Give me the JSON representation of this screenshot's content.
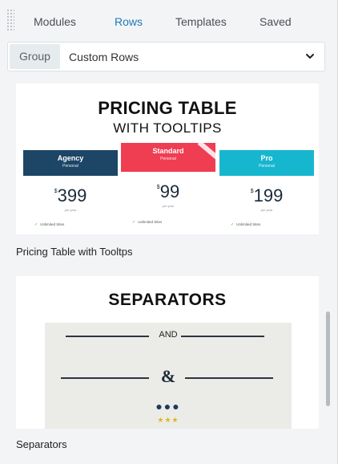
{
  "tabs": [
    {
      "label": "Modules",
      "active": false
    },
    {
      "label": "Rows",
      "active": true
    },
    {
      "label": "Templates",
      "active": false
    },
    {
      "label": "Saved",
      "active": false
    }
  ],
  "selector": {
    "group_label": "Group",
    "value": "Custom Rows",
    "icon": "chevron-down-icon"
  },
  "colors": {
    "accent": "#1e79b8",
    "agency": "#1d4566",
    "standard": "#ef3d52",
    "pro": "#17b6cf"
  },
  "items": [
    {
      "caption": "Pricing Table with Tooltps",
      "thumbnail": {
        "title_line1": "PRICING TABLE",
        "title_line2": "WITH TOOLTIPS",
        "plans": [
          {
            "name": "Agency",
            "sub": "Personal",
            "price": "399",
            "currency": "$",
            "per": "per year",
            "feature": "Unlimited Sites"
          },
          {
            "name": "Standard",
            "sub": "Personal",
            "price": "99",
            "currency": "$",
            "per": "per year",
            "feature": "Unlimited Sites"
          },
          {
            "name": "Pro",
            "sub": "Personal",
            "price": "199",
            "currency": "$",
            "per": "per year",
            "feature": "Unlimited Sites"
          }
        ]
      }
    },
    {
      "caption": "Separators",
      "thumbnail": {
        "title": "SEPARATORS",
        "and_text": "AND",
        "amp": "&",
        "dots": "●●●",
        "stars": "★★★"
      }
    }
  ]
}
